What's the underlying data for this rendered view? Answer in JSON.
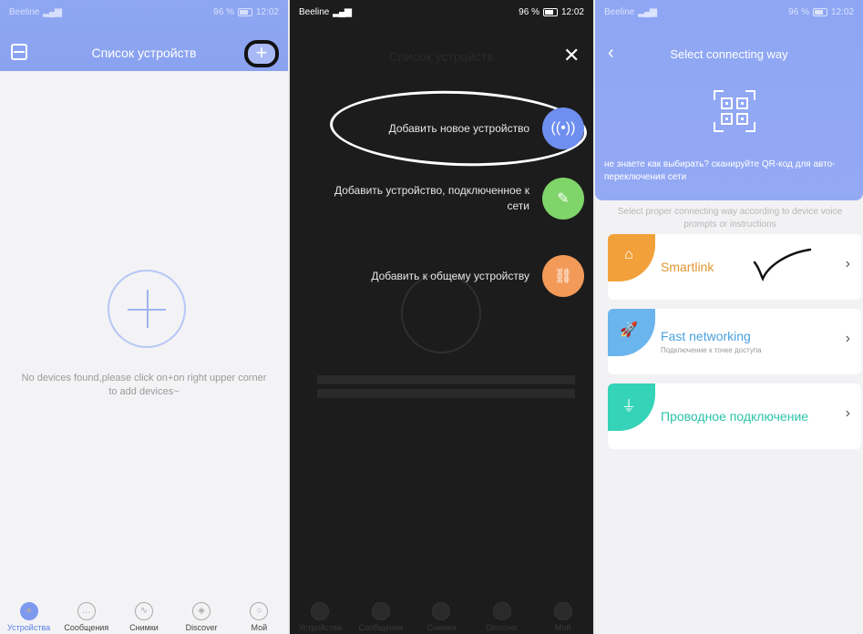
{
  "panel1": {
    "status": {
      "carrier": "Beeline",
      "battery": "96 %",
      "time": "12:02"
    },
    "title": "Список устройств",
    "add_icon": "plus-icon",
    "scan_icon": "scan-icon",
    "empty_message": "No devices found,please click on+on right upper corner to add devices~",
    "tabs": [
      {
        "label": "Устройства",
        "icon": "camera-icon"
      },
      {
        "label": "Сообщения",
        "icon": "message-icon"
      },
      {
        "label": "Снимки",
        "icon": "image-icon"
      },
      {
        "label": "Discover",
        "icon": "compass-icon"
      },
      {
        "label": "Мой",
        "icon": "person-icon"
      }
    ],
    "accent": "#8aa2ef"
  },
  "panel2": {
    "status": {
      "carrier": "Beeline",
      "battery": "96 %",
      "time": "12:02"
    },
    "title": "Список устройств",
    "options": [
      {
        "label": "Добавить новое устройство",
        "icon": "wireless-icon",
        "color": "#6f8ff0"
      },
      {
        "label": "Добавить устройство, подключенное к сети",
        "icon": "edit-icon",
        "color": "#7fd46a"
      },
      {
        "label": "Добавить к общему устройству",
        "icon": "link-icon",
        "color": "#f39a58"
      }
    ],
    "tabs": [
      {
        "label": "Устройства"
      },
      {
        "label": "Сообщения"
      },
      {
        "label": "Снимки"
      },
      {
        "label": "Discover"
      },
      {
        "label": "Мой"
      }
    ]
  },
  "panel3": {
    "status": {
      "carrier": "Beeline",
      "battery": "96 %",
      "time": "12:02"
    },
    "title": "Select connecting way",
    "qr_hint": "не знаете как выбирать? сканируйте QR-код для авто-переключения сети",
    "subtitle": "Select proper connecting way according to device voice prompts or instructions",
    "cards": [
      {
        "name": "Smartlink",
        "desc": "",
        "icon": "android-icon",
        "color": "#f2a13a"
      },
      {
        "name": "Fast networking",
        "desc": "Подключение к точке доступа",
        "icon": "rocket-icon",
        "color": "#6ab5ee"
      },
      {
        "name": "Проводное подключение",
        "desc": "",
        "icon": "plug-icon",
        "color": "#35d3b8"
      }
    ]
  }
}
